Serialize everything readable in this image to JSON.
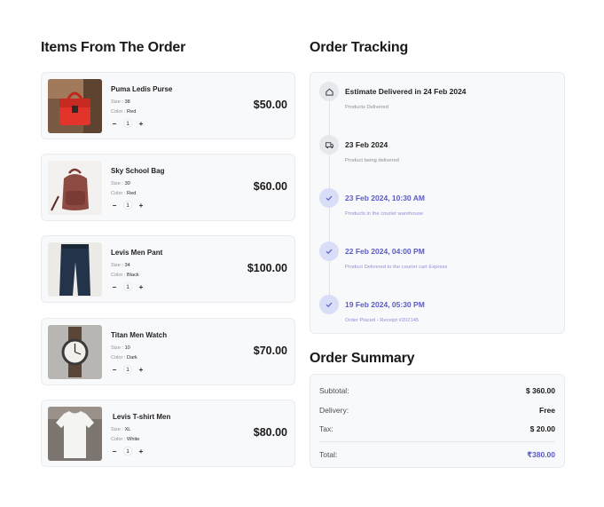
{
  "items_title": "Items From The Order",
  "tracking_title": "Order Tracking",
  "summary_title": "Order Summary",
  "items": [
    {
      "name": "Puma Ledis Purse",
      "size_label": "Size :",
      "size": "38",
      "color_label": "Color :",
      "color": "Red",
      "qty": "1",
      "price": "$50.00",
      "image": "red-handbag"
    },
    {
      "name": "Sky School Bag",
      "size_label": "Size :",
      "size": "30",
      "color_label": "Color :",
      "color": "Red",
      "qty": "1",
      "price": "$60.00",
      "image": "brown-backpack"
    },
    {
      "name": "Levis Men Pant",
      "size_label": "Size :",
      "size": "34",
      "color_label": "Color :",
      "color": "Black",
      "qty": "1",
      "price": "$100.00",
      "image": "jeans"
    },
    {
      "name": "Titan Men Watch",
      "size_label": "Size :",
      "size": "10",
      "color_label": "Color :",
      "color": "Dark",
      "qty": "1",
      "price": "$70.00",
      "image": "wrist-watch"
    },
    {
      "name": "Levis T-shirt Men",
      "size_label": "Size :",
      "size": "XL",
      "color_label": "Color :",
      "color": "White",
      "qty": "1",
      "price": "$80.00",
      "image": "white-tshirt"
    }
  ],
  "qty_minus": "−",
  "qty_plus": "+",
  "tracking": [
    {
      "title": "Estimate Delivered in 24 Feb 2024",
      "subtitle": "Products Delivered",
      "icon": "home-icon",
      "state": "pending"
    },
    {
      "title": "23 Feb 2024",
      "subtitle": "Product being delivered",
      "icon": "truck-icon",
      "state": "pending"
    },
    {
      "title": "23 Feb 2024, 10:30 AM",
      "subtitle": "Products in the courier warehouse",
      "icon": "check-icon",
      "state": "done"
    },
    {
      "title": "22 Feb 2024, 04:00 PM",
      "subtitle": "Product Delivered to the courier cart Express",
      "icon": "check-icon",
      "state": "done"
    },
    {
      "title": "19 Feb 2024, 05:30 PM",
      "subtitle": "Order Placed - Receipt #202145",
      "icon": "check-icon",
      "state": "done"
    }
  ],
  "summary": {
    "subtotal_label": "Subtotal:",
    "subtotal": "$ 360.00",
    "delivery_label": "Delivery:",
    "delivery": "Free",
    "tax_label": "Tax:",
    "tax": "$ 20.00",
    "total_label": "Total:",
    "total": "₹380.00"
  },
  "colors": {
    "accent": "#5b5bc6",
    "card_bg": "#f8f9fb",
    "done_circle": "#d9ddf8"
  }
}
